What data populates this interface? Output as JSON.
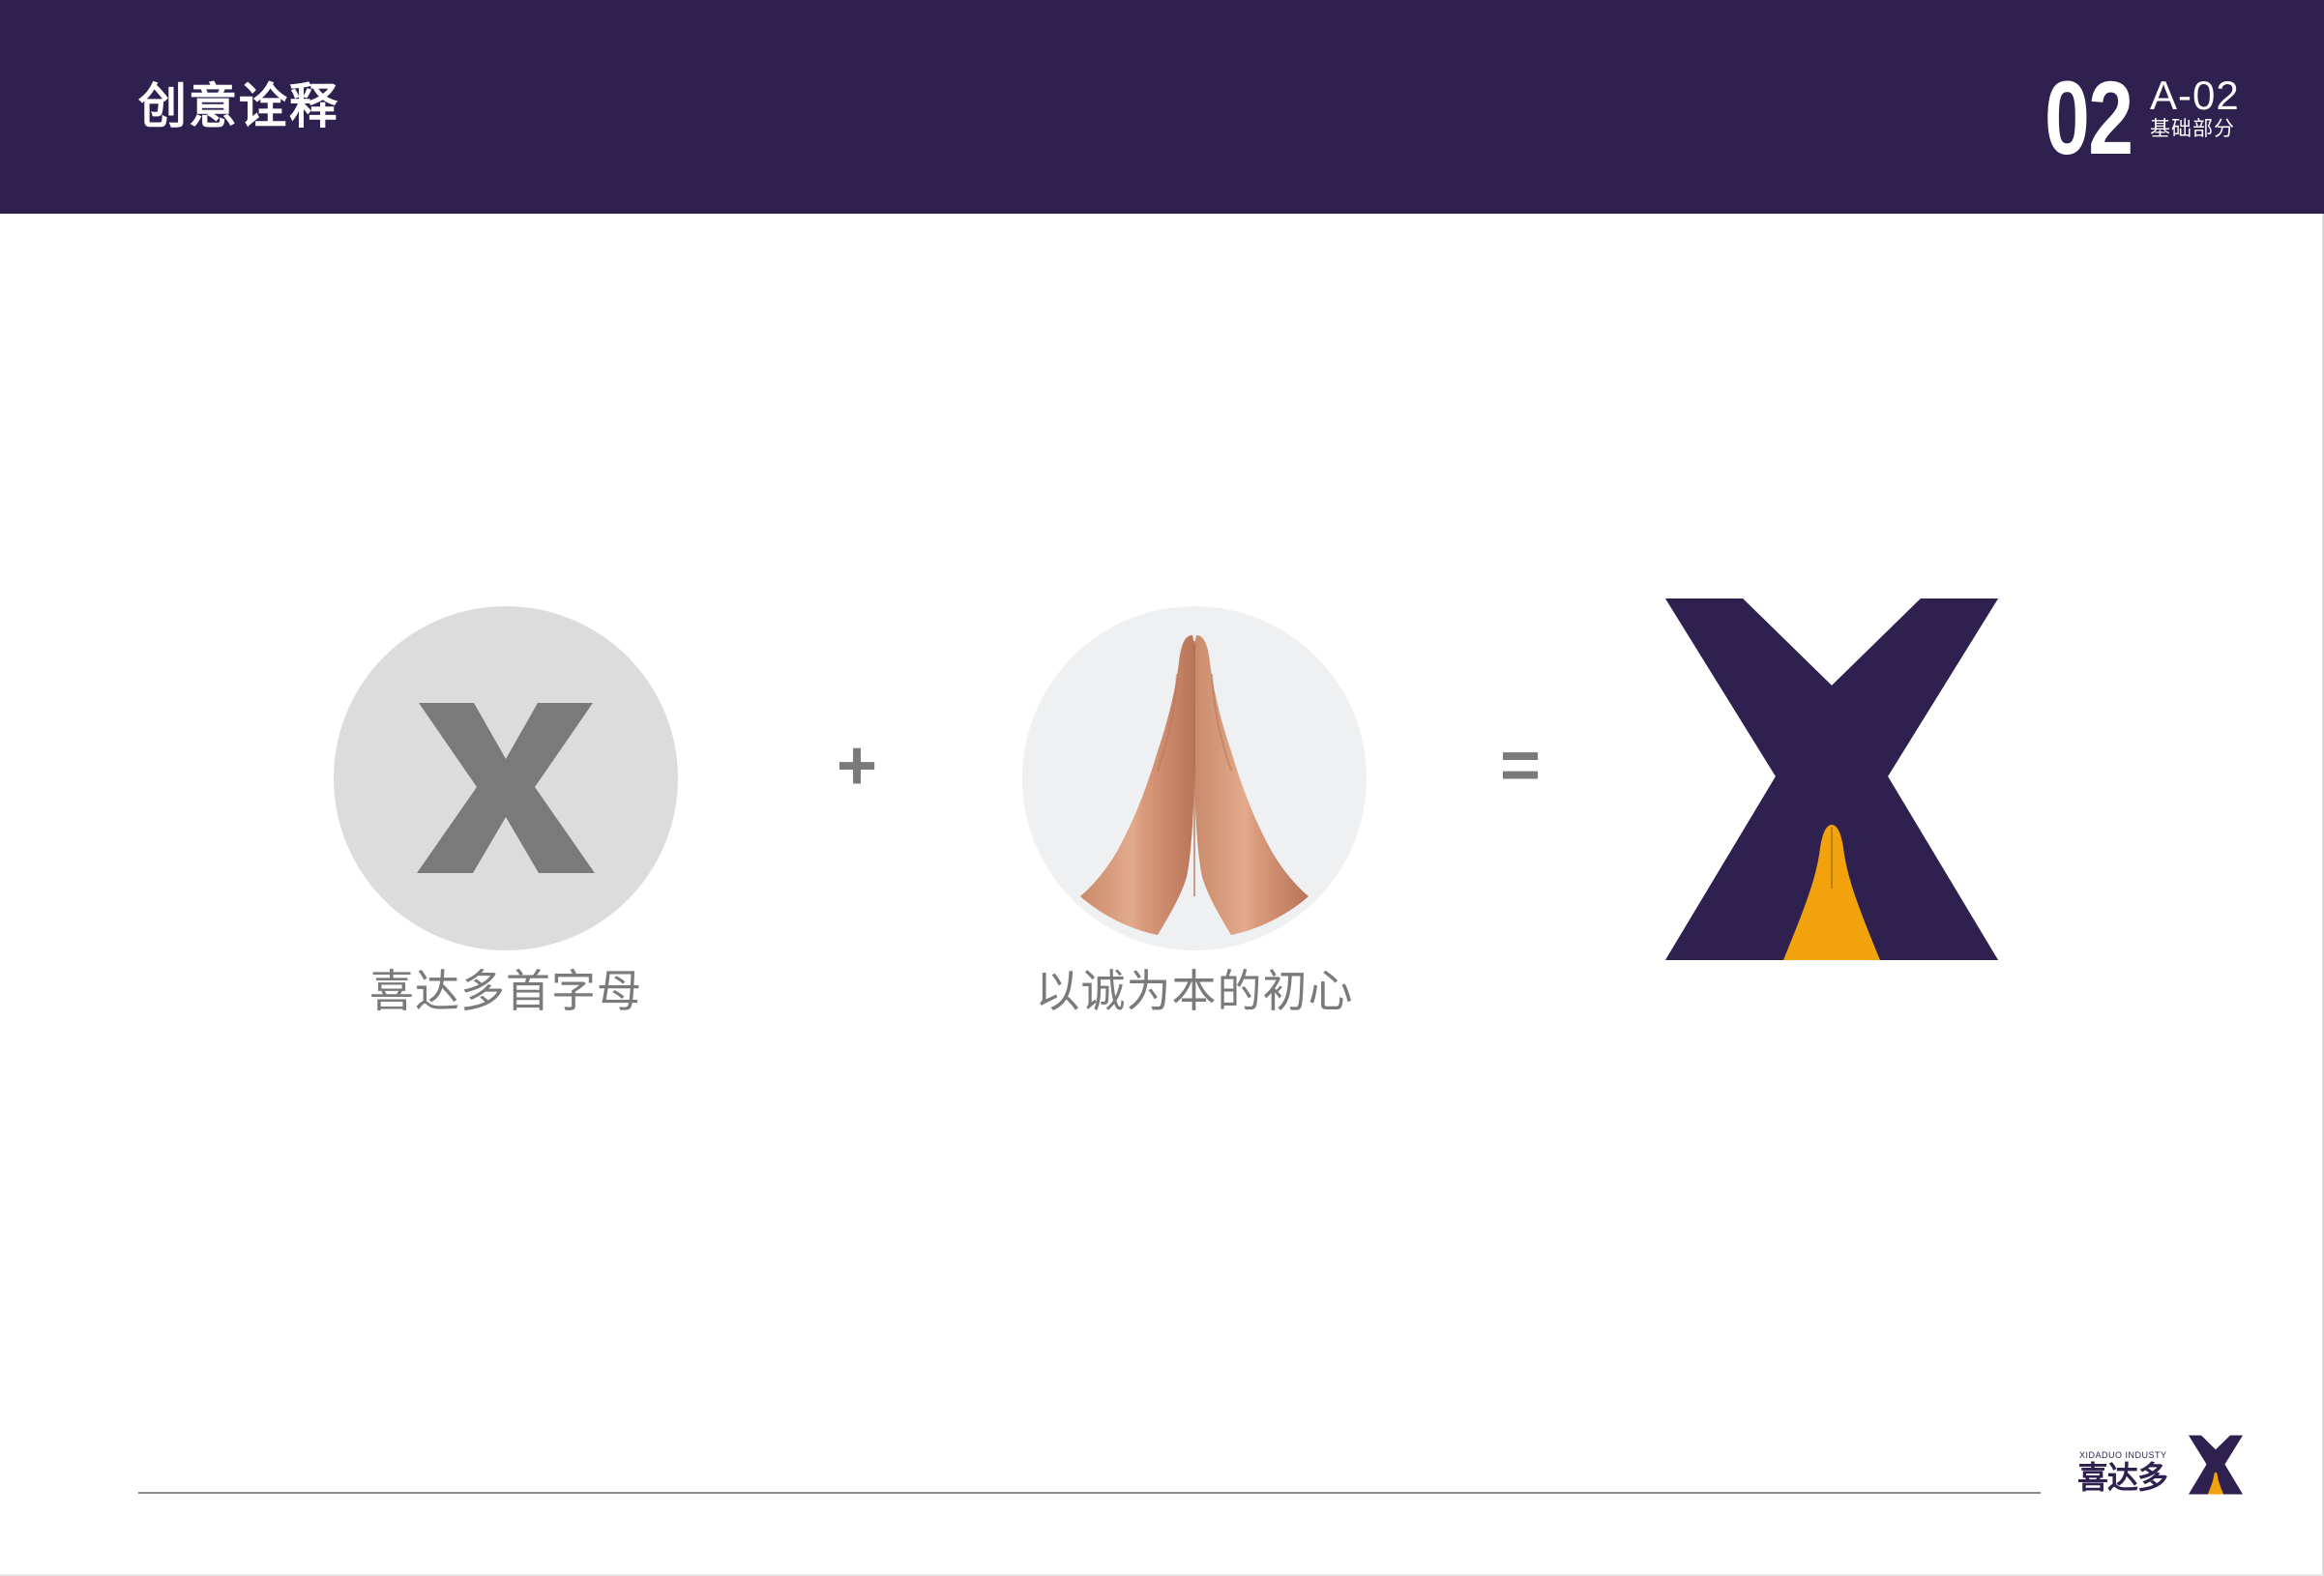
{
  "header": {
    "title": "创意诠释",
    "section_number": "02",
    "section_code": "A-02",
    "section_name": "基础部分"
  },
  "colors": {
    "brand_purple": "#2e2150",
    "brand_orange": "#f2a20a",
    "gray": "#7a7a7a",
    "circle_gray": "#dcdcdc"
  },
  "formula": {
    "item1": {
      "icon": "letter-x-icon",
      "caption": "喜达多首字母"
    },
    "operator1": "+",
    "item2": {
      "icon": "praying-hands-image",
      "caption": "以诚为本的初心"
    },
    "operator2": "=",
    "result": {
      "icon": "brand-x-logo"
    }
  },
  "footer": {
    "brand_en": "XIDADUO INDUSTY",
    "brand_cn": "喜达多"
  }
}
